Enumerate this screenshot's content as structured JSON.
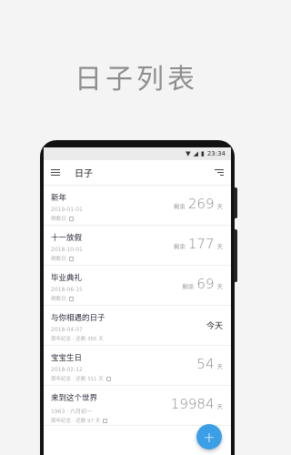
{
  "headline": "日子列表",
  "status": {
    "time": "23:34"
  },
  "toolbar": {
    "title": "日子"
  },
  "items": [
    {
      "name": "新年",
      "date": "2019-01-01",
      "tag": "倒数日",
      "prefix": "剩余",
      "count": "269",
      "unit": "天"
    },
    {
      "name": "十一放假",
      "date": "2018-10-01",
      "tag": "倒数日",
      "prefix": "剩余",
      "count": "177",
      "unit": "天"
    },
    {
      "name": "毕业典礼",
      "date": "2018-06-15",
      "tag": "倒数日",
      "prefix": "剩余",
      "count": "69",
      "unit": "天"
    },
    {
      "name": "与你相遇的日子",
      "date": "2018-04-07",
      "tag": "周年纪念 · 还剩 365 天",
      "prefix": "",
      "count": "",
      "unit": "",
      "today": "今天"
    },
    {
      "name": "宝宝生日",
      "date": "2018-02-12",
      "tag": "周年纪念 · 还剩 311 天",
      "prefix": "",
      "count": "54",
      "unit": "天"
    },
    {
      "name": "来到这个世界",
      "date": "1963 · 六月初一",
      "tag": "周年纪念 · 还剩 97 天",
      "prefix": "",
      "count": "19984",
      "unit": "天"
    }
  ],
  "fab": {
    "label": "+"
  },
  "colors": {
    "accent": "#3b9fe8"
  }
}
